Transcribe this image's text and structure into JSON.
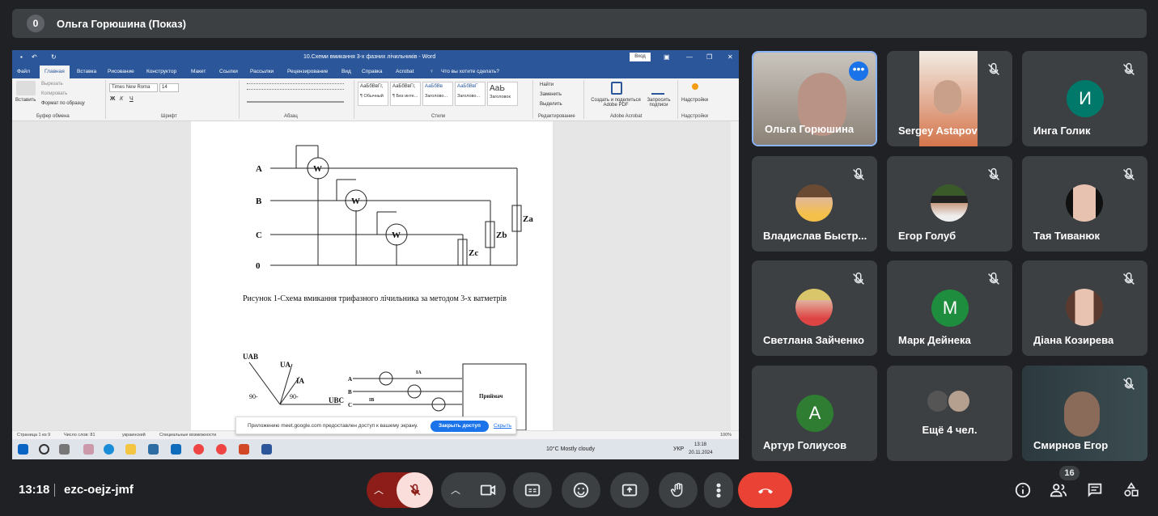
{
  "top_bar": {
    "count": "0",
    "title": "Ольга Горюшина (Показ)"
  },
  "word": {
    "title": "10.Схеми вмикання 3-х фазних лічильників - Word",
    "signin": "Вход",
    "tabs": [
      "Файл",
      "Главная",
      "Вставка",
      "Рисование",
      "Конструктор",
      "Макет",
      "Ссылки",
      "Рассылки",
      "Рецензирование",
      "Вид",
      "Справка",
      "Acrobat"
    ],
    "tell_me": "Что вы хотите сделать?",
    "ribbon": {
      "paste": "Вставить",
      "cut": "Вырезать",
      "copy": "Копировать",
      "format_painter": "Формат по образцу",
      "font_name": "Times New Roma",
      "font_size": "14",
      "groups": [
        "Буфер обмена",
        "Шрифт",
        "Абзац",
        "Стили",
        "Редактирование",
        "Adobe Acrobat",
        "Надстройки"
      ],
      "styles": [
        {
          "sample": "АаБбВвГг,",
          "name": "¶ Обычный"
        },
        {
          "sample": "АаБбВвГг,",
          "name": "¶ Без инте..."
        },
        {
          "sample": "АаБбВв",
          "name": "Заголово..."
        },
        {
          "sample": "АаБбВвГ",
          "name": "Заголово..."
        },
        {
          "sample": "АаЬ",
          "name": "Заголовок"
        }
      ],
      "find": "Найти",
      "replace": "Заменить",
      "select": "Выделить",
      "adobe_create": "Создать и поделиться Adobe PDF",
      "adobe_request": "Запросить подписи",
      "addins": "Надстройки"
    },
    "figure_caption": "Рисунок 1-Схема вмикання трифазного лічильника за методом 3-х ватметрів",
    "diagram1_labels": {
      "a": "A",
      "b": "B",
      "c": "C",
      "zero": "0",
      "w": "W",
      "za": "Za",
      "zb": "Zb",
      "zc": "Zc"
    },
    "diagram2_labels": {
      "uab": "UAB",
      "ua": "UA",
      "ia": "IA",
      "ubc": "UBC",
      "angle1": "90-",
      "angle2": "90-",
      "receiver": "Приймач",
      "a": "A",
      "b": "B",
      "c": "C",
      "ia2": "IA",
      "ib": "IB"
    },
    "status": {
      "page": "Страница 1 из 9",
      "words": "Число слов: 81",
      "lang": "украинский",
      "access": "Специальные возможности",
      "zoom": "100%"
    },
    "share_notice": {
      "message": "Приложению meet.google.com предоставлен доступ к вашему экрану.",
      "stop": "Закрыть доступ",
      "hide": "Скрыть"
    },
    "taskbar": {
      "weather": "10°C  Mostly cloudy",
      "lang": "УКР",
      "time": "13:18",
      "date": "20.11.2024"
    }
  },
  "participants": [
    {
      "name": "Ольга Горюшина",
      "type": "video"
    },
    {
      "name": "Sergey Astapov",
      "type": "video"
    },
    {
      "name": "Инга Голик",
      "type": "letter",
      "letter": "И",
      "color": "#00796b"
    },
    {
      "name": "Владислав Быстр...",
      "type": "photo"
    },
    {
      "name": "Егор Голуб",
      "type": "photo"
    },
    {
      "name": "Тая Тиванюк",
      "type": "photo"
    },
    {
      "name": "Светлана Зайченко",
      "type": "photo"
    },
    {
      "name": "Марк Дейнека",
      "type": "letter",
      "letter": "М",
      "color": "#1e8e3e"
    },
    {
      "name": "Діана Козирева",
      "type": "photo"
    },
    {
      "name": "Артур Голиусов",
      "type": "letter",
      "letter": "А",
      "color": "#2e7d32"
    },
    {
      "name": "Ещё 4 чел.",
      "type": "more"
    },
    {
      "name": "Смирнов Егор",
      "type": "video"
    }
  ],
  "bottom_bar": {
    "time": "13:18",
    "meeting_code": "ezc-oejz-jmf",
    "people_count": "16"
  },
  "colors": {
    "end_call": "#ea4335",
    "mic_off": "#f9dedc",
    "mic_off_arrow": "#8c1d18",
    "accent": "#8ab4f8"
  }
}
